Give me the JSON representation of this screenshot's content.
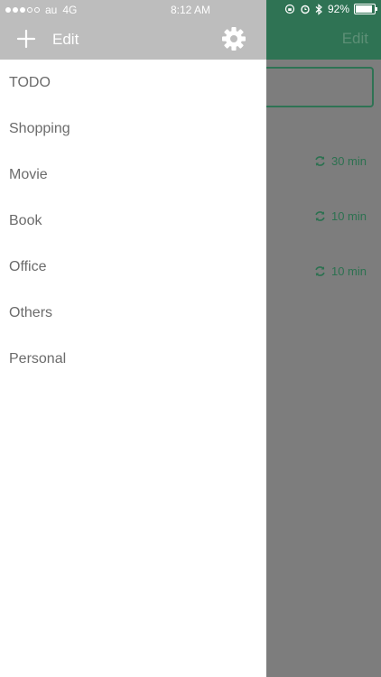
{
  "status_bar": {
    "carrier": "au",
    "network": "4G",
    "time": "8:12 AM",
    "battery": "92%"
  },
  "drawer": {
    "edit_label": "Edit",
    "items": [
      {
        "label": "TODO"
      },
      {
        "label": "Shopping"
      },
      {
        "label": "Movie"
      },
      {
        "label": "Book"
      },
      {
        "label": "Office"
      },
      {
        "label": "Others"
      },
      {
        "label": "Personal"
      }
    ]
  },
  "main": {
    "edit_label": "Edit",
    "rows": [
      {
        "duration": "30 min"
      },
      {
        "duration": "10 min"
      },
      {
        "duration": "10 min"
      }
    ]
  },
  "colors": {
    "accent": "#2f7354",
    "drawer_header": "#bdbdbd",
    "overlay": "#7d7d7d"
  }
}
